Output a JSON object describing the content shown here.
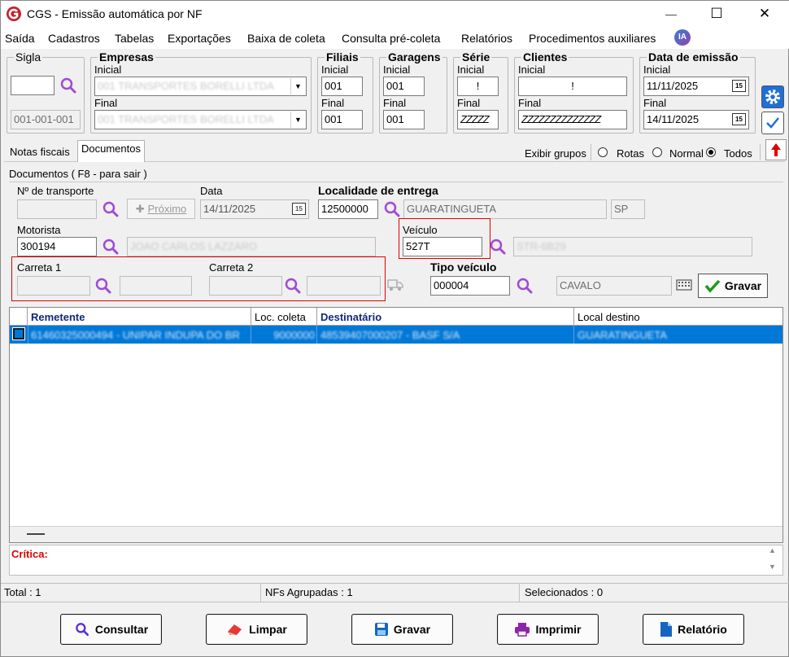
{
  "window": {
    "title": "CGS - Emissão automática por NF",
    "minimize": "—",
    "maximize": "☐",
    "close": "✕"
  },
  "menu": [
    "Saída",
    "Cadastros",
    "Tabelas",
    "Exportações",
    "Baixa de coleta",
    "Consulta pré-coleta",
    "Relatórios",
    "Procedimentos auxiliares"
  ],
  "ia_badge": "IA",
  "sigla": {
    "title": "Sigla",
    "value": "",
    "code": "001-001-001"
  },
  "empresas": {
    "title": "Empresas",
    "inicial_label": "Inicial",
    "inicial_value": "001 TRANSPORTES BORELLI LTDA",
    "final_label": "Final",
    "final_value": "001 TRANSPORTES BORELLI LTDA"
  },
  "filiais": {
    "title": "Filiais",
    "inicial_label": "Inicial",
    "inicial": "001",
    "final_label": "Final",
    "final": "001"
  },
  "garagens": {
    "title": "Garagens",
    "inicial_label": "Inicial",
    "inicial": "001",
    "final_label": "Final",
    "final": "001"
  },
  "serie": {
    "title": "Série",
    "inicial_label": "Inicial",
    "inicial": "!",
    "final_label": "Final",
    "final": "ZZZZZ"
  },
  "clientes": {
    "title": "Clientes",
    "inicial_label": "Inicial",
    "inicial": "!",
    "final_label": "Final",
    "final": "ZZZZZZZZZZZZZZ"
  },
  "data_emissao": {
    "title": "Data de emissão",
    "inicial_label": "Inicial",
    "inicial": "11/11/2025",
    "final_label": "Final",
    "final": "14/11/2025",
    "cal_icon": "15"
  },
  "tabs": {
    "notas": "Notas fiscais",
    "documentos": "Documentos"
  },
  "exibir": {
    "label": "Exibir grupos",
    "rotas": "Rotas",
    "normal": "Normal",
    "todos": "Todos"
  },
  "doc": {
    "header": "Documentos ( F8 - para sair )",
    "transporte_label": "Nº de transporte",
    "transporte": "",
    "proximo": "Próximo",
    "data_label": "Data",
    "data": "14/11/2025",
    "localidade_label": "Localidade de entrega",
    "localidade_code": "12500000",
    "localidade_nome": "GUARATINGUETA",
    "uf": "SP",
    "motorista_label": "Motorista",
    "motorista_code": "300194",
    "motorista_nome": "JOAO CARLOS LAZZARO",
    "veiculo_label": "Veículo",
    "veiculo": "527T",
    "veiculo_desc": "STR-6B29",
    "carreta1_label": "Carreta 1",
    "carreta2_label": "Carreta 2",
    "tipo_label": "Tipo veículo",
    "tipo_code": "000004",
    "tipo_nome": "CAVALO",
    "gravar": "Gravar"
  },
  "grid": {
    "headers": [
      "Remetente",
      "Loc. coleta",
      "Destinatário",
      "Local destino"
    ],
    "rows": [
      {
        "remetente": "61460325000494 - UNIPAR INDUPA DO BR",
        "loc_coleta": "9000000",
        "destinatario": "48539407000207 - BASF S/A",
        "local_destino": "GUARATINGUETA"
      }
    ]
  },
  "critica": "Crítica:",
  "status": {
    "total": "Total : 1",
    "nfs": "NFs Agrupadas : 1",
    "selecionados": "Selecionados : 0"
  },
  "buttons": {
    "consultar": "Consultar",
    "limpar": "Limpar",
    "gravar": "Gravar",
    "imprimir": "Imprimir",
    "relatorio": "Relatório"
  },
  "colors": {
    "accent": "#0078d7",
    "logo": "#c8202f",
    "highlight": "#e00000",
    "critica": "#e00000"
  }
}
